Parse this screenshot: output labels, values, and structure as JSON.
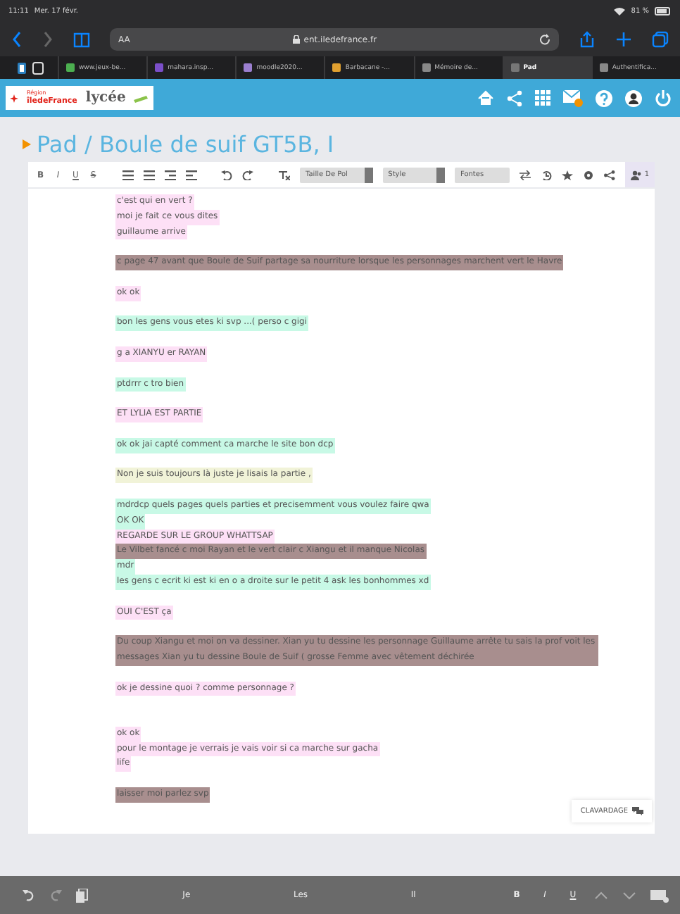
{
  "status_bar": {
    "time": "11:11",
    "date": "Mer. 17 févr.",
    "battery": "81 %"
  },
  "browser": {
    "reader": "AA",
    "url": "ent.iledefrance.fr"
  },
  "tabs": [
    {
      "label": "www.jeux-be...",
      "selected": false
    },
    {
      "label": "mahara.insp...",
      "selected": false
    },
    {
      "label": "moodle2020...",
      "selected": false
    },
    {
      "label": "Barbacane -...",
      "selected": false
    },
    {
      "label": "Mémoire de...",
      "selected": false
    },
    {
      "label": "Pad",
      "selected": true
    },
    {
      "label": "Authentifica...",
      "selected": false
    }
  ],
  "header": {
    "logo_top": "Région",
    "logo_region": "îledeFrance",
    "logo_lycee": "lycée"
  },
  "pad": {
    "title": "Pad / Boule de suif GT5B, I",
    "format": [
      "B",
      "I",
      "U",
      "S"
    ],
    "selects": [
      "Taille De Pol",
      "Style",
      "Fontes"
    ],
    "users_count": "1",
    "lines": [
      {
        "kind": "text",
        "text": "c'est qui en vert ?",
        "color": "#fde0f6"
      },
      {
        "kind": "text",
        "text": "moi je fait ce vous dites",
        "color": "#fde0f6"
      },
      {
        "kind": "text",
        "text": "guillaume arrive",
        "color": "#fde0f6"
      },
      {
        "kind": "blank"
      },
      {
        "kind": "text",
        "text": "c page 47 avant que Boule de Suif partage sa nourriture lorsque les personnages marchent vert le Havre",
        "color": "#a88e8e"
      },
      {
        "kind": "blank"
      },
      {
        "kind": "text",
        "text": "ok ok",
        "color": "#fde0f6"
      },
      {
        "kind": "blank"
      },
      {
        "kind": "text",
        "text": "bon les gens vous etes ki svp ...( perso c gigi",
        "color": "#c8f9e6"
      },
      {
        "kind": "blank"
      },
      {
        "kind": "text",
        "text": "g a XIANYU  er RAYAN",
        "color": "#fde0f6"
      },
      {
        "kind": "blank"
      },
      {
        "kind": "text",
        "text": "ptdrrr c tro bien",
        "color": "#c8f9e6"
      },
      {
        "kind": "blank"
      },
      {
        "kind": "text",
        "text": "ET LYLIA EST PARTIE",
        "color": "#fde0f6"
      },
      {
        "kind": "blank"
      },
      {
        "kind": "text",
        "text": "ok ok jai capté comment ca marche le site bon dcp",
        "color": "#c8f9e6"
      },
      {
        "kind": "blank"
      },
      {
        "kind": "text",
        "text": "Non je suis toujours là juste je lisais la partie ,",
        "color": "#f1f3d8"
      },
      {
        "kind": "blank"
      },
      {
        "kind": "text",
        "text": "mdrdcp quels pages quels parties et precisemment vous voulez faire qwa",
        "color": "#c8f9e6"
      },
      {
        "kind": "text",
        "text": "OK OK",
        "color": "#c8f9e6"
      },
      {
        "kind": "text",
        "text": "REGARDE SUR LE GROUP WHATTSAP",
        "color": "#fde0f6"
      },
      {
        "kind": "text",
        "text": "Le Vilbet fancé c moi Rayan et le vert clair c Xiangu et il manque Nicolas",
        "color": "#a88e8e"
      },
      {
        "kind": "text",
        "text": "mdr",
        "color": "#c8f9e6"
      },
      {
        "kind": "text",
        "text": "les gens c ecrit ki est ki en o a droite sur le petit 4 ask les bonhommes xd",
        "color": "#c8f9e6"
      },
      {
        "kind": "blank"
      },
      {
        "kind": "text",
        "text": "OUI C'EST ça",
        "color": "#fde0f6"
      },
      {
        "kind": "blank"
      },
      {
        "kind": "text",
        "text": "Du coup Xiangu et moi on va dessiner. Xian yu tu dessine les personnage Guillaume arrête tu sais la prof voit les messages Xian yu tu dessine Boule de Suif ( grosse Femme avec vêtement déchirée",
        "color": "#a88e8e"
      },
      {
        "kind": "blank"
      },
      {
        "kind": "text",
        "text": "ok je dessine quoi ? comme personnage ?",
        "color": "#fde0f6"
      },
      {
        "kind": "blank"
      },
      {
        "kind": "blank"
      },
      {
        "kind": "text",
        "text": "ok ok",
        "color": "#fde0f6"
      },
      {
        "kind": "text",
        "text": "pour le montage je verrais je vais voir si ca marche sur gacha",
        "color": "#fde0f6"
      },
      {
        "kind": "text",
        "text": "life",
        "color": "#fde0f6"
      },
      {
        "kind": "blank"
      },
      {
        "kind": "text",
        "text": "laisser moi parlez svp",
        "color": "#a88e8e"
      }
    ],
    "chat_button": "CLAVARDAGE"
  },
  "keyboard": {
    "suggestions": [
      "Je",
      "Les",
      "Il"
    ],
    "format": [
      "B",
      "I",
      "U"
    ]
  }
}
